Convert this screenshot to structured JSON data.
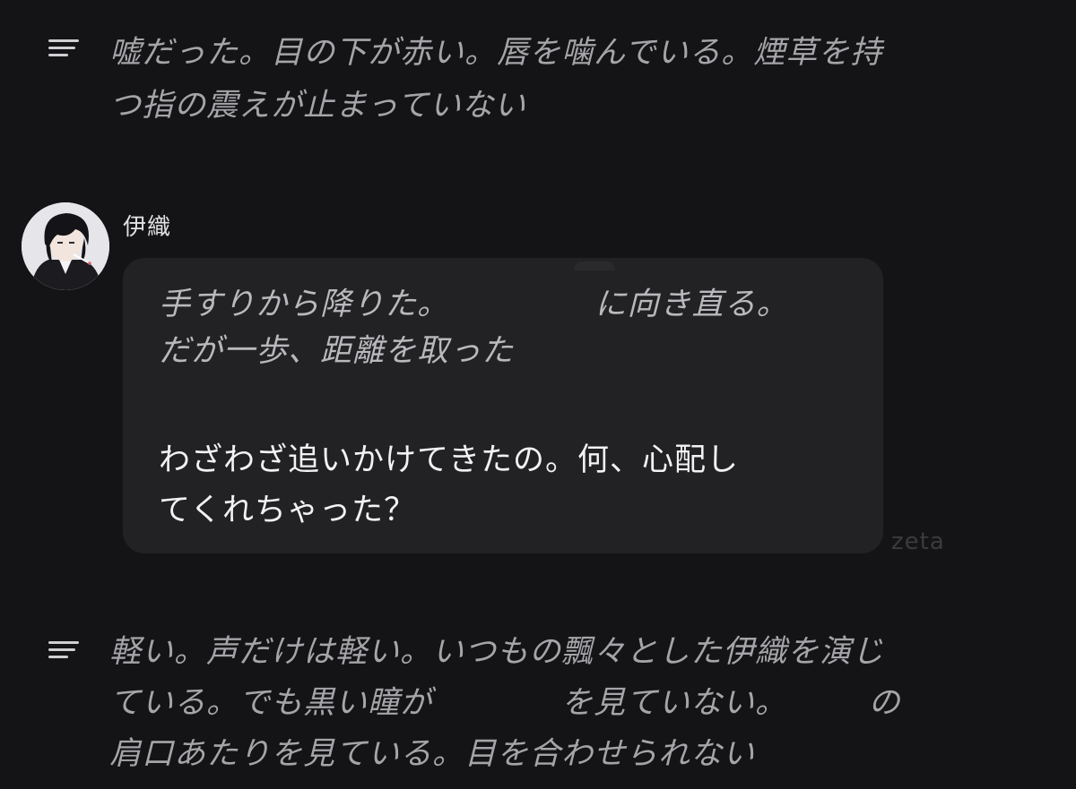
{
  "narration_top": {
    "icon": "narration-lines-icon",
    "text": "嘘だった。目の下が赤い。唇を噛んでいる。煙草を持\nつ指の震えが止まっていない"
  },
  "message": {
    "speaker": "伊織",
    "avatar_icon": "character-avatar",
    "action": "手すりから降りた。　　　　　に向き直る。\nだが一歩、距離を取った",
    "speech": "わざわざ追いかけてきたの。何、心配し\nてくれちゃった？"
  },
  "watermark": "zeta",
  "narration_bottom": {
    "icon": "narration-lines-icon",
    "text": "軽い。声だけは軽い。いつもの飄々とした伊織を演じ\nている。でも黒い瞳が　　　　を見ていない。　　　の\n肩口あたりを見ている。目を合わせられない"
  },
  "colors": {
    "background": "#141416",
    "bubble": "#222224",
    "narration_text": "#a5a5a9",
    "speech_text": "#f2f2f4"
  }
}
